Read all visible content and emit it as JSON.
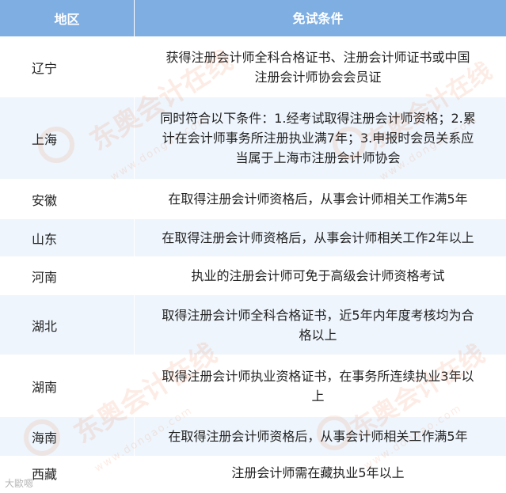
{
  "header": {
    "region": "地区",
    "condition": "免试条件"
  },
  "rows": [
    {
      "region": "辽宁",
      "lines": [
        "获得注册会计师全科合格证书、注册会计师证书或中国",
        "注册会计师协会会员证"
      ]
    },
    {
      "region": "上海",
      "lines": [
        "同时符合以下条件：1.经考试取得注册会计师资格；2.累",
        "计在会计师事务所注册执业满7年；3.申报时会员关系应",
        "当属于上海市注册会计师协会"
      ]
    },
    {
      "region": "安徽",
      "lines": [
        "在取得注册会计师资格后，从事会计师相关工作满5年"
      ]
    },
    {
      "region": "山东",
      "lines": [
        "在取得注册会计师资格后，从事会计师相关工作2年以上"
      ]
    },
    {
      "region": "河南",
      "lines": [
        "执业的注册会计师可免于高级会计师资格考试"
      ]
    },
    {
      "region": "湖北",
      "lines": [
        "取得注册会计师全科合格证书，近5年内年度考核均为合",
        "格以上"
      ]
    },
    {
      "region": "湖南",
      "lines": [
        "取得注册会计师执业资格证书，在事务所连续执业3年以",
        "上"
      ]
    },
    {
      "region": "海南",
      "lines": [
        "在取得注册会计师资格后，从事会计师相关工作满5年"
      ]
    },
    {
      "region": "西藏",
      "lines": [
        "注册会计师需在藏执业5年以上"
      ]
    }
  ],
  "watermark": {
    "text": "东奥会计在线",
    "sub": "www.dongao.com"
  },
  "credit": "大歐嗯"
}
